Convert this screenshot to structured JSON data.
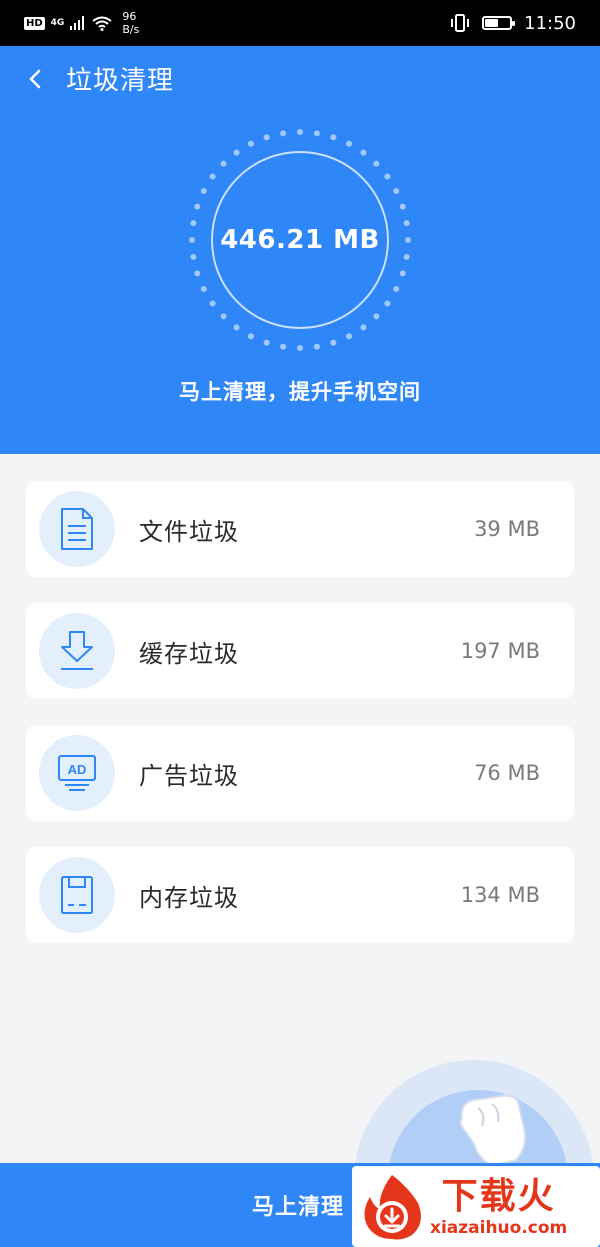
{
  "status_bar": {
    "hd": "HD",
    "network": "4G",
    "speed_value": "96",
    "speed_unit": "B/s",
    "time": "11:50",
    "battery_level": 0.55
  },
  "header": {
    "title": "垃圾清理",
    "total_size": "446.21 MB",
    "subtitle": "马上清理，提升手机空间"
  },
  "items": [
    {
      "label": "文件垃圾",
      "size": "39 MB",
      "icon": "document-icon"
    },
    {
      "label": "缓存垃圾",
      "size": "197 MB",
      "icon": "download-icon"
    },
    {
      "label": "广告垃圾",
      "size": "76 MB",
      "icon": "ad-icon"
    },
    {
      "label": "内存垃圾",
      "size": "134 MB",
      "icon": "memory-card-icon"
    }
  ],
  "clean_button": {
    "label": "马上清理"
  },
  "watermark": {
    "name": "下载火",
    "domain": "xiazaihuo.com"
  },
  "colors": {
    "primary": "#2f86f6",
    "icon_bg": "#e4effc",
    "icon_stroke": "#2f86f6",
    "watermark": "#e5361b"
  }
}
